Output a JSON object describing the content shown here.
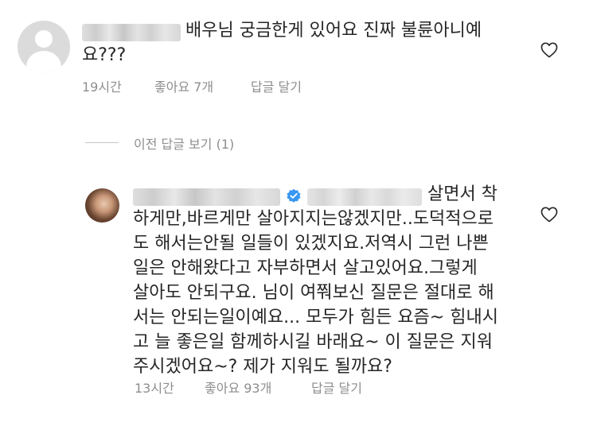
{
  "comment": {
    "text_line1": "배우님 궁금한게 있어요 진짜 불륜아니예",
    "text_line2": "요???",
    "time": "19시간",
    "likes": "좋아요 7개",
    "reply_label": "답글 달기"
  },
  "view_replies": {
    "label": "이전 답글 보기 (1)"
  },
  "reply": {
    "lines": [
      "살면서 착",
      "하게만,바르게만 살아지지는않겠지만..도덕적으로",
      "도 해서는안될 일들이 있겠지요.저역시 그런 나쁜",
      "일은 안해왔다고 자부하면서 살고있어요.그렇게",
      "살아도 안되구요. 님이 여쭤보신 질문은 절대로 해",
      "서는 안되는일이예요... 모두가 힘든 요즘~ 힘내시",
      "고 늘 좋은일 함께하시길 바래요~ 이 질문은 지워",
      "주시겠어요~? 제가 지워도 될까요?"
    ],
    "time": "13시간",
    "likes": "좋아요 93개",
    "reply_label": "답글 달기"
  },
  "icons": {
    "like": "heart-outline-icon",
    "verified": "verified-badge-icon",
    "default_avatar": "default-avatar-icon"
  },
  "colors": {
    "text": "#262626",
    "meta": "#8e8e8e",
    "verified": "#3897f0"
  }
}
